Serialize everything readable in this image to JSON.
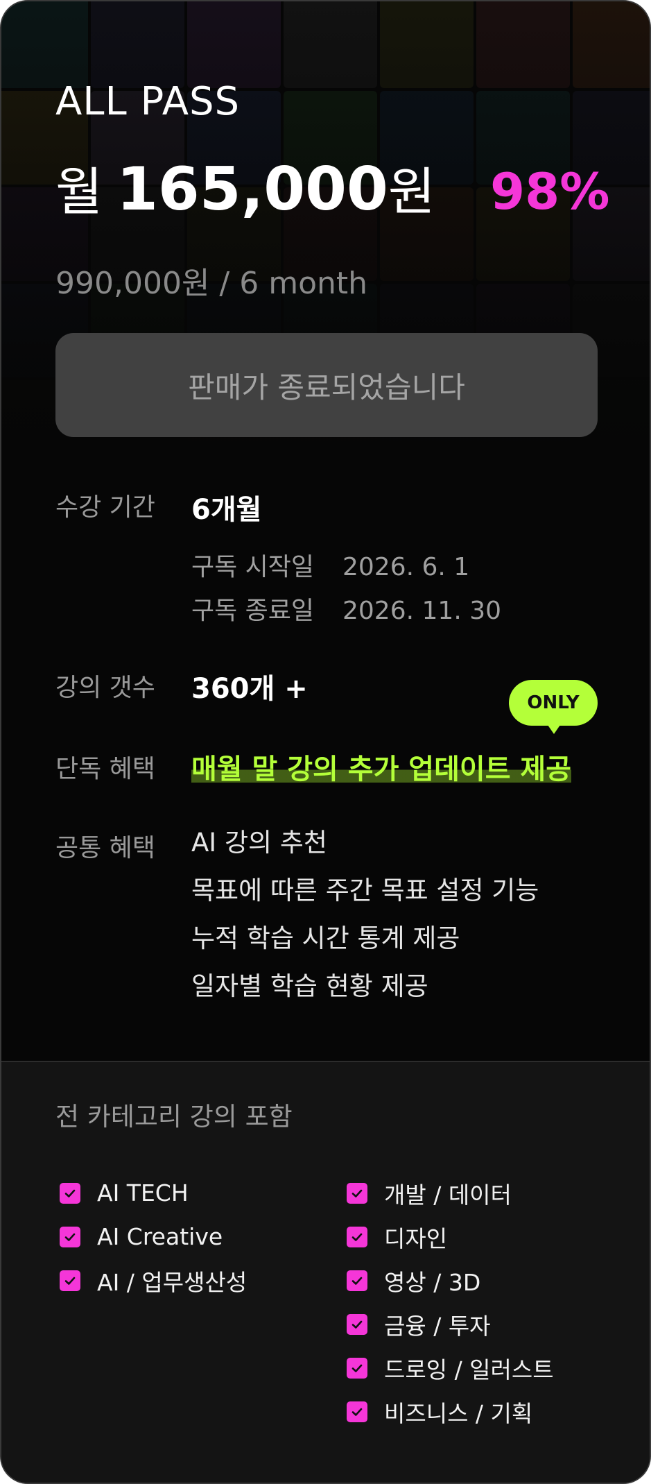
{
  "plan": {
    "name": "ALL PASS",
    "price_prefix": "월",
    "price_amount": "165,000",
    "price_suffix": "원",
    "discount": "98%",
    "price_sub": "990,000원 / 6 month"
  },
  "purchase": {
    "button_label": "판매가 종료되었습니다"
  },
  "details": {
    "period_label": "수강 기간",
    "period_value": "6개월",
    "start_label": "구독 시작일",
    "start_value": "2026. 6. 1",
    "end_label": "구독 종료일",
    "end_value": "2026. 11. 30",
    "count_label": "강의 갯수",
    "count_value": "360개 +",
    "exclusive_label": "단독 혜택",
    "exclusive_value": "매월 말 강의 추가 업데이트 제공",
    "only_badge": "ONLY",
    "common_label": "공통 혜택",
    "common_items": [
      "AI 강의 추천",
      "목표에 따른 주간 목표 설정 기능",
      "누적 학습 시간 통계 제공",
      "일자별 학습 현황 제공"
    ]
  },
  "categories": {
    "title": "전 카테고리 강의 포함",
    "left": [
      "AI TECH",
      "AI Creative",
      "AI / 업무생산성"
    ],
    "right": [
      "개발 / 데이터",
      "디자인",
      "영상 / 3D",
      "금융 / 투자",
      "드로잉 / 일러스트",
      "비즈니스 / 기획"
    ],
    "check_icon": "check-icon",
    "accent_color": "#f536d8",
    "highlight_color": "#b4ff39"
  }
}
